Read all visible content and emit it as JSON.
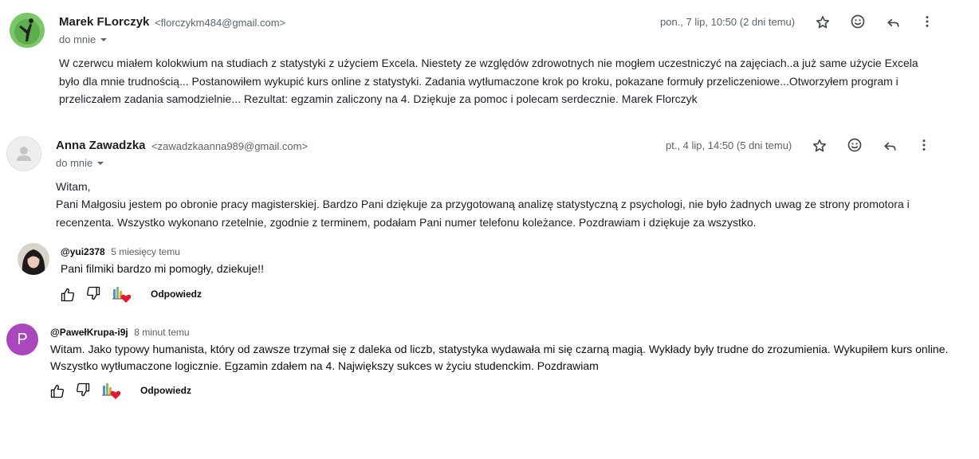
{
  "emails": [
    {
      "sender": "Marek FLorczyk",
      "email": "<florczykm484@gmail.com>",
      "to": "do mnie",
      "date": "pon., 7 lip, 10:50 (2 dni temu)",
      "body": "W czerwcu miałem kolokwium na studiach z statystyki z użyciem Excela. Niestety ze względów zdrowotnych nie mogłem uczestniczyć na zajęciach..a już same użycie Excela było dla mnie trudnością... Postanowiłem wykupić kurs online z statystyki. Zadania wytłumaczone krok po kroku, pokazane formuły przeliczeniowe...Otworzyłem program i przeliczałem zadania samodzielnie... Rezultat: egzamin zaliczony na 4. Dziękuje za pomoc i polecam serdecznie. Marek Florczyk"
    },
    {
      "sender": "Anna Zawadzka",
      "email": "<zawadzkaanna989@gmail.com>",
      "to": "do mnie",
      "date": "pt., 4 lip, 14:50 (5 dni temu)",
      "greeting": "Witam,",
      "body": "Pani Małgosiu jestem po obronie pracy magisterskiej. Bardzo Pani dziękuje za przygotowaną analizę statystyczną z psychologi, nie było żadnych uwag ze strony promotora i recenzenta. Wszystko wykonano rzetelnie, zgodnie z terminem, podałam Pani numer telefonu koleżance. Pozdrawiam i dziękuje za wszystko."
    }
  ],
  "comments": [
    {
      "handle": "@yui2378",
      "time": "5 miesięcy temu",
      "text": "Pani filmiki bardzo mi pomogły, dziekuje!!",
      "reply_label": "Odpowiedz"
    },
    {
      "handle": "@PawełKrupa-i9j",
      "time": "8 minut temu",
      "avatar_letter": "P",
      "avatar_color": "#ab47bc",
      "text": "Witam. Jako typowy humanista, który od zawsze trzymał się z daleka od liczb, statystyka wydawała mi się czarną magią. Wykłady były trudne do zrozumienia. Wykupiłem kurs online. Wszystko wytłumaczone logicznie. Egzamin zdałem na 4. Największy sukces w życiu studenckim. Pozdrawiam",
      "reply_label": "Odpowiedz"
    }
  ]
}
